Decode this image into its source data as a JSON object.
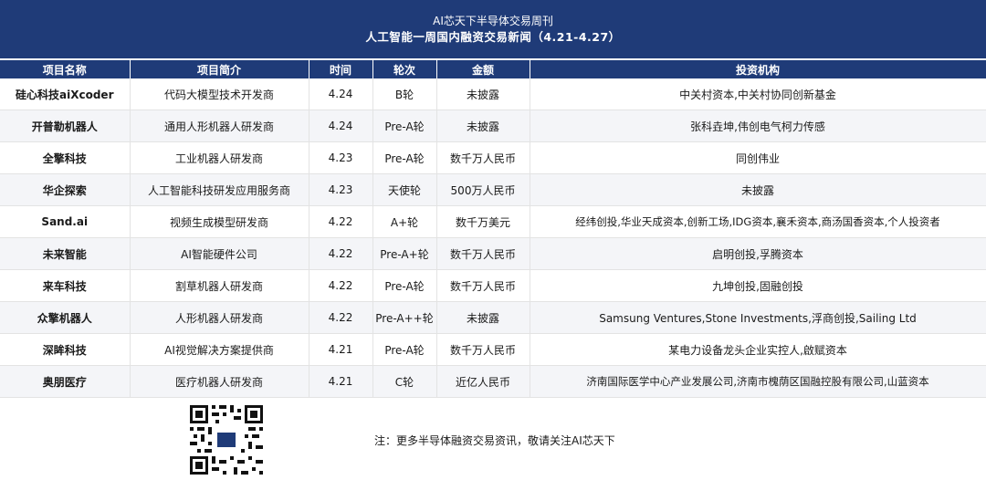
{
  "header": {
    "title": "AI芯天下半导体交易周刊",
    "subtitle": "人工智能一周国内融资交易新闻（4.21-4.27）"
  },
  "table": {
    "columns": [
      "项目名称",
      "项目简介",
      "时间",
      "轮次",
      "金额",
      "投资机构"
    ],
    "rows": [
      [
        "硅心科技aiXcoder",
        "代码大模型技术开发商",
        "4.24",
        "B轮",
        "未披露",
        "中关村资本,中关村协同创新基金"
      ],
      [
        "开普勒机器人",
        "通用人形机器人研发商",
        "4.24",
        "Pre-A轮",
        "未披露",
        "张科垚坤,伟创电气柯力传感"
      ],
      [
        "全擎科技",
        "工业机器人研发商",
        "4.23",
        "Pre-A轮",
        "数千万人民币",
        "同创伟业"
      ],
      [
        "华企探索",
        "人工智能科技研发应用服务商",
        "4.23",
        "天使轮",
        "500万人民币",
        "未披露"
      ],
      [
        "Sand.ai",
        "视频生成模型研发商",
        "4.22",
        "A+轮",
        "数千万美元",
        "经纬创投,华业天成资本,创新工场,IDG资本,襄禾资本,商汤国香资本,个人投资者"
      ],
      [
        "未来智能",
        "AI智能硬件公司",
        "4.22",
        "Pre-A+轮",
        "数千万人民币",
        "启明创投,孚腾资本"
      ],
      [
        "来车科技",
        "割草机器人研发商",
        "4.22",
        "Pre-A轮",
        "数千万人民币",
        "九坤创投,固融创投"
      ],
      [
        "众擎机器人",
        "人形机器人研发商",
        "4.22",
        "Pre-A++轮",
        "未披露",
        "Samsung Ventures,Stone Investments,浮商创投,Sailing Ltd"
      ],
      [
        "深眸科技",
        "AI视觉解决方案提供商",
        "4.21",
        "Pre-A轮",
        "数千万人民币",
        "某电力设备龙头企业实控人,啟赋资本"
      ],
      [
        "奥朋医疗",
        "医疗机器人研发商",
        "4.21",
        "C轮",
        "近亿人民币",
        "济南国际医学中心产业发展公司,济南市槐荫区国融控股有限公司,山蓝资本"
      ]
    ]
  },
  "footer": {
    "note": "注：更多半导体融资交易资讯，敬请关注AI芯天下"
  },
  "colors": {
    "header_bg": "#1f3b78",
    "header_text": "#ffffff"
  }
}
